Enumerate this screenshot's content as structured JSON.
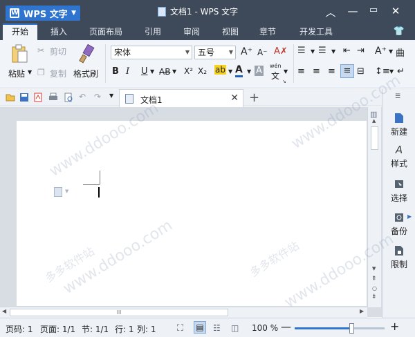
{
  "app": {
    "name": "WPS 文字",
    "window_title": "文档1 - WPS 文字"
  },
  "menu": {
    "tabs": [
      "开始",
      "插入",
      "页面布局",
      "引用",
      "审阅",
      "视图",
      "章节",
      "开发工具"
    ],
    "active": "开始"
  },
  "ribbon": {
    "paste": "粘贴",
    "cut": "剪切",
    "copy": "复制",
    "format_painter": "格式刷",
    "font_name": "宋体",
    "font_size": "五号",
    "bold": "B",
    "italic": "I",
    "underline": "U",
    "strikethrough": "AB",
    "superscript": "X²",
    "subscript": "X₂",
    "grow_font": "A⁺",
    "shrink_font": "A⁻",
    "pinyin": "wén",
    "pinyin_char": "文"
  },
  "document_tab": {
    "label": "文档1"
  },
  "side_panel": {
    "items": [
      "新建",
      "样式",
      "选择",
      "备份",
      "限制"
    ]
  },
  "status": {
    "page_code": "页码: 1",
    "page": "页面: 1/1",
    "section": "节: 1/1",
    "row": "行: 1",
    "column": "列: 1",
    "zoom": "100 %",
    "zoom_level": 0.63
  },
  "watermark": [
    "www.ddooo.com",
    "多多软件站"
  ],
  "colors": {
    "titlebar": "#3e4a59",
    "accent": "#2f74cf",
    "highlight_yellow": "#f7d21c",
    "font_color_blue": "#1e5fb8",
    "pdf_red": "#d63b2f"
  }
}
